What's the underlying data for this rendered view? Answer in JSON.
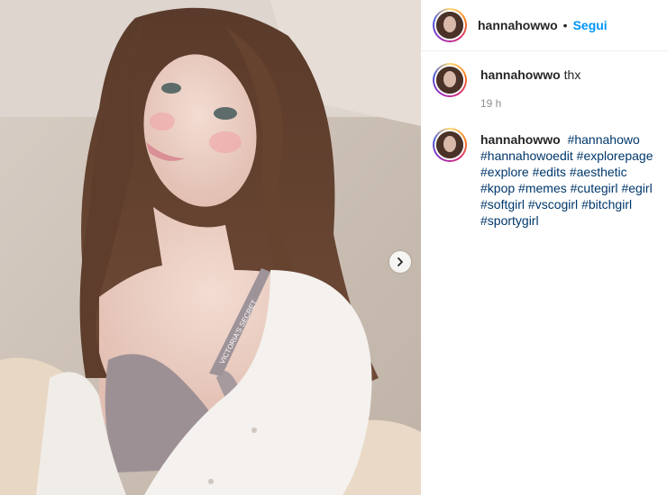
{
  "post": {
    "username": "hannahowwo",
    "separator": "•",
    "follow_label": "Segui"
  },
  "comments": [
    {
      "username": "hannahowwo",
      "text": "thx",
      "time": "19 h"
    },
    {
      "username": "hannahowwo",
      "tags": [
        "#hannahowo",
        "#hannahowoedit",
        "#explorepage",
        "#explore",
        "#edits",
        "#aesthetic",
        "#kpop",
        "#memes",
        "#cutegirl",
        "#egirl",
        "#softgirl",
        "#vscogirl",
        "#bitchgirl",
        "#sportygirl"
      ]
    }
  ],
  "photo": {
    "strap_text": "VICTORIA'S SECRET"
  },
  "icons": {
    "carousel": "chevron-right-icon"
  },
  "colors": {
    "follow": "#0095f6",
    "hashtag": "#00376b",
    "time": "#8e8e8e"
  }
}
